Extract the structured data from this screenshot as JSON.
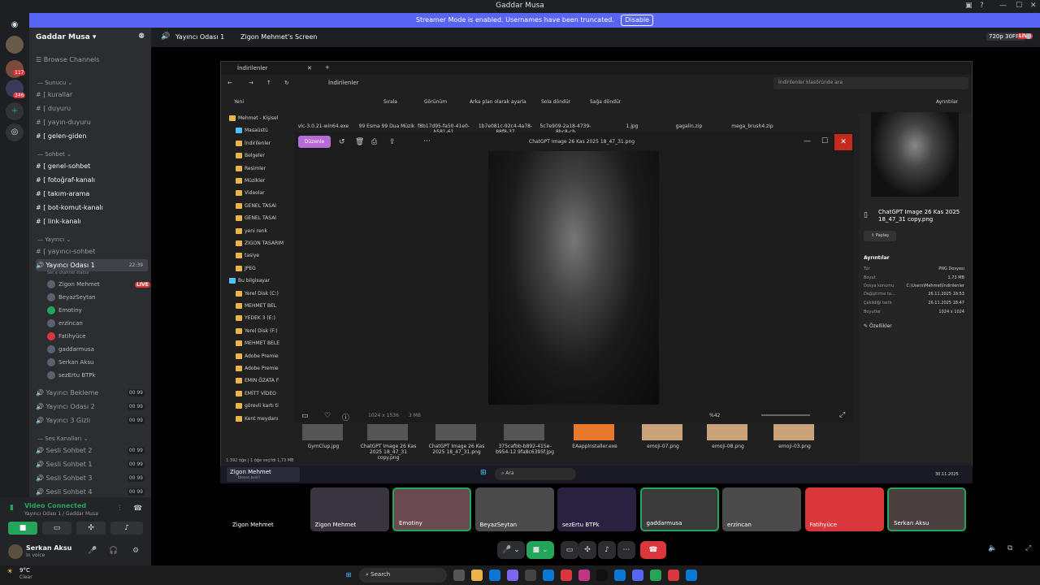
{
  "window": {
    "title": "Gaddar Musa"
  },
  "banner": {
    "text": "Streamer Mode is enabled. Usernames have been truncated.",
    "disable": "Disable"
  },
  "guilds": {
    "badges": [
      "117",
      "346"
    ]
  },
  "server": {
    "name": "Gaddar Musa",
    "browse": "Browse Channels"
  },
  "categories": {
    "sunucu": "Sunucu",
    "sohbet": "Sohbet",
    "yayinci": "Yayıncı",
    "ses": "Ses Kanalları"
  },
  "channels": {
    "sunucu": [
      "kurallar",
      "duyuru",
      "yayın-duyuru",
      "gelen-giden"
    ],
    "sohbet": [
      "genel-sohbet",
      "fotoğraf-kanalı",
      "takım-arama",
      "bot-komut-kanalı",
      "link-kanalı"
    ],
    "yayinci_text": "yayıncı-sohbet"
  },
  "voice": {
    "active": {
      "name": "Yayıncı Odası 1",
      "timer": "22:39",
      "status": "Set a channel status"
    },
    "users": [
      "Zigon Mehmet",
      "BeyazSeytan",
      "Emotiny",
      "erzincan",
      "Fatihyüce",
      "gaddarmusa",
      "Serkan Aksu",
      "sezErtu BTPk"
    ],
    "live_label": "LIVE",
    "others": [
      {
        "name": "Yayıncı Bekleme",
        "count": "00 99"
      },
      {
        "name": "Yayıncı Odası 2",
        "count": "00 99"
      },
      {
        "name": "Yayıncı 3 Gizli",
        "count": "00 99"
      }
    ],
    "ses": [
      {
        "name": "Sesli Sohbet 2",
        "count": "00 99"
      },
      {
        "name": "Sesli Sohbet 1",
        "count": "00 99"
      },
      {
        "name": "Sesli Sohbet 3",
        "count": "00 99"
      },
      {
        "name": "Sesli Sohbet 4",
        "count": "00 99"
      }
    ]
  },
  "voice_connected": {
    "title": "Video Connected",
    "sub": "Yayıncı Odası 1 / Gaddar Musa"
  },
  "user": {
    "name": "Serkan Aksu",
    "status": "In voice"
  },
  "topbar": {
    "channel": "Yayıncı Odası 1",
    "screen": "Zigon Mehmet's Screen",
    "quality": "720p 30FPS",
    "live": "LIVE"
  },
  "explorer": {
    "tab": "İndirilenler",
    "path": "İndirilenler",
    "search_placeholder": "İndirilenler klasöründe ara",
    "toolbar": [
      "Yeni",
      "Sırala",
      "Görünüm",
      "Arka plan olarak ayarla",
      "Sola döndür",
      "Sağa döndür",
      "Ayrıntılar"
    ],
    "top_files": [
      "vlc-3.0.21-win64.exe",
      "99 Esma 99 Dua Müzik",
      "f8b17d95-fa50-41e0-b581-61",
      "1b7e081c-92c4-4a78-88f8-37",
      "5c7e909-2a18-4739-8bc8-cb",
      "1.jpg",
      "gagalin.zip",
      "mega_brush4.zip"
    ],
    "nav": [
      "Mehmet - Kişisel",
      "Masaüstü",
      "İndirilenler",
      "Belgeler",
      "Resimler",
      "Müzikler",
      "Videolar",
      "GENEL TASAI",
      "GENEL TASAI",
      "yeni renk",
      "ZIGON TASARIM",
      "tasiye",
      "JPEG",
      "Bu bilgisayar",
      "Yerel Disk (C:)",
      "MEHMET BEL",
      "YEDEK 3 (E:)",
      "Yerel Disk (F:)",
      "MEHMET BELE",
      "Adobe Premie",
      "Adobe Premie",
      "EMIN ÖZATA F",
      "EMİTT VİDEO",
      "görevli kartı ti",
      "Kent meydanı"
    ],
    "bottom_files": [
      "GymClup.jpg",
      "ChatGPT Image 26 Kas 2025 18_47_31 copy.png",
      "ChatGPT Image 26 Kas 2025 18_47_31.png",
      "375cafbb-b892-415e-b954-12 9fa8c6395f.jpg",
      "EAappInstaller.exe",
      "emoji-07.png",
      "emoji-08.png",
      "emoji-03.png"
    ],
    "status": "1.392 öğe | 1 öğe seçildi 1,73 MB"
  },
  "viewer": {
    "edit": "Düzenle",
    "title": "ChatGPT Image 26 Kas 2025 18_47_31.png",
    "size_info": "1024 x 1536",
    "filesize": "3 MB",
    "zoom": "%42"
  },
  "details": {
    "filename": "ChatGPT Image 26 Kas 2025 18_47_31 copy.png",
    "share": "Paylaş",
    "heading": "Ayrıntılar",
    "rows": [
      {
        "k": "Tür",
        "v": "PNG Dosyası"
      },
      {
        "k": "Boyut",
        "v": "1,73 MB"
      },
      {
        "k": "Dosya konumu",
        "v": "C:\\Users\\Mehmet\\İndirilenler"
      },
      {
        "k": "Değiştirme ta...",
        "v": "26.11.2025 18:53"
      },
      {
        "k": "Çekildiği tarih",
        "v": "26.11.2025 18:47"
      },
      {
        "k": "Boyutlar",
        "v": "1024 x 1024"
      }
    ],
    "properties": "Özellikler"
  },
  "shared_taskbar": {
    "search": "Ara",
    "time": "30.11.2025",
    "label": "Zigon Mehmet",
    "sub": "İzlenen belirli"
  },
  "tiles": [
    "Zigon Mehmet",
    "Zigon Mehmet",
    "Emotiny",
    "BeyazSeytan",
    "sezErtu BTPk",
    "gaddarmusa",
    "erzincan",
    "Fatihyüce",
    "Serkan Aksu"
  ],
  "taskbar": {
    "weather": "9°C",
    "weather_sub": "Clear",
    "search": "Search"
  },
  "colors": {
    "blurple": "#5865f2",
    "green": "#23a55a",
    "red": "#da373c"
  }
}
